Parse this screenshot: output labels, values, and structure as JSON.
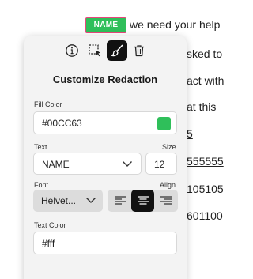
{
  "document": {
    "lines": [
      {
        "text": "we need your help",
        "underlined": false
      },
      {
        "text": "sked to",
        "underlined": false
      },
      {
        "text": "act with",
        "underlined": false
      },
      {
        "text": "at this",
        "underlined": false
      },
      {
        "text": "5",
        "underlined": true
      },
      {
        "text": "555555",
        "underlined": true
      },
      {
        "text": "105105",
        "underlined": true
      },
      {
        "text": "601100",
        "underlined": true
      }
    ],
    "redaction_label": "NAME",
    "redaction_color": "#2fbf5a",
    "redaction_border": "#e8467c"
  },
  "toolbar": {
    "tools": [
      {
        "icon": "info-icon",
        "active": false
      },
      {
        "icon": "select-region-icon",
        "active": false
      },
      {
        "icon": "brush-icon",
        "active": true
      },
      {
        "icon": "trash-icon",
        "active": false
      }
    ]
  },
  "panel": {
    "title": "Customize Redaction",
    "fill_color": {
      "label": "Fill Color",
      "value": "#00CC63",
      "swatch": "#2fbf5a"
    },
    "text": {
      "label": "Text",
      "value": "NAME"
    },
    "size": {
      "label": "Size",
      "value": "12"
    },
    "font": {
      "label": "Font",
      "value": "Helvet..."
    },
    "align": {
      "label": "Align",
      "options": [
        "left",
        "center",
        "right"
      ],
      "selected": "center"
    },
    "text_color": {
      "label": "Text Color",
      "value": "#fff"
    }
  }
}
